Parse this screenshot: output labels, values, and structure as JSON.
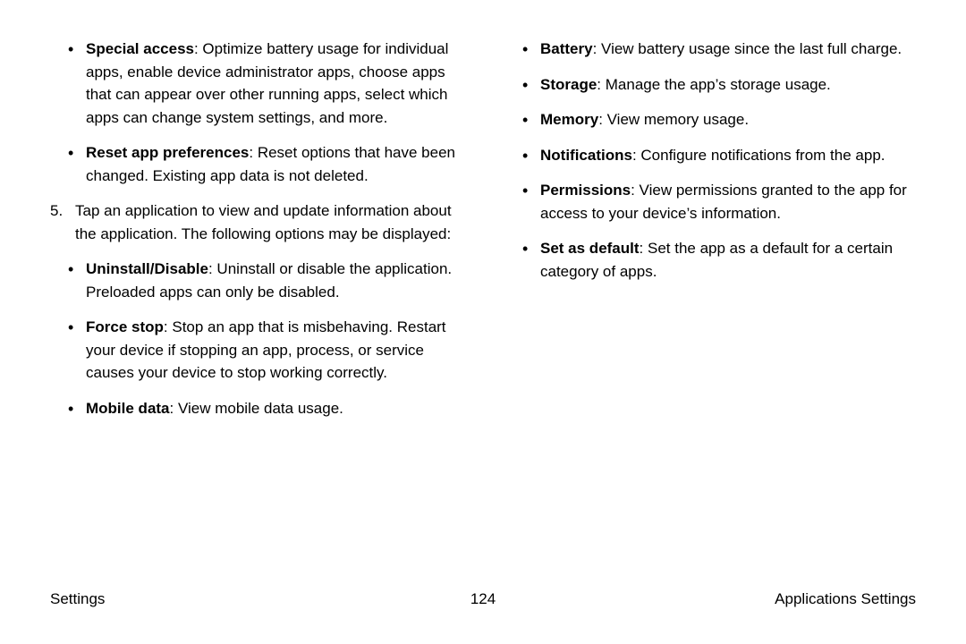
{
  "left": {
    "top_bullets": [
      {
        "term": "Special access",
        "desc": ": Optimize battery usage for individual apps, enable device administrator apps, choose apps that can appear over other running apps, select which apps can change system settings, and more."
      },
      {
        "term": "Reset app preferences",
        "desc": ": Reset options that have been changed. Existing app data is not deleted."
      }
    ],
    "step_number": "5.",
    "step_text": "Tap an application to view and update information about the application. The following options may be displayed:",
    "step_bullets": [
      {
        "term": "Uninstall/Disable",
        "desc": ": Uninstall or disable the application. Preloaded apps can only be disabled."
      },
      {
        "term": "Force stop",
        "desc": ": Stop an app that is misbehaving. Restart your device if stopping an app, process, or service causes your device to stop working correctly."
      },
      {
        "term": "Mobile data",
        "desc": ": View mobile data usage."
      }
    ]
  },
  "right": {
    "bullets": [
      {
        "term": "Battery",
        "desc": ": View battery usage since the last full charge."
      },
      {
        "term": "Storage",
        "desc": ": Manage the app’s storage usage."
      },
      {
        "term": "Memory",
        "desc": ": View memory usage."
      },
      {
        "term": "Notifications",
        "desc": ": Configure notifications from the app."
      },
      {
        "term": "Permissions",
        "desc": ": View permissions granted to the app for access to your device’s information."
      },
      {
        "term": "Set as default",
        "desc": ": Set the app as a default for a certain category of apps."
      }
    ]
  },
  "footer": {
    "left": "Settings",
    "center": "124",
    "right": "Applications Settings"
  }
}
